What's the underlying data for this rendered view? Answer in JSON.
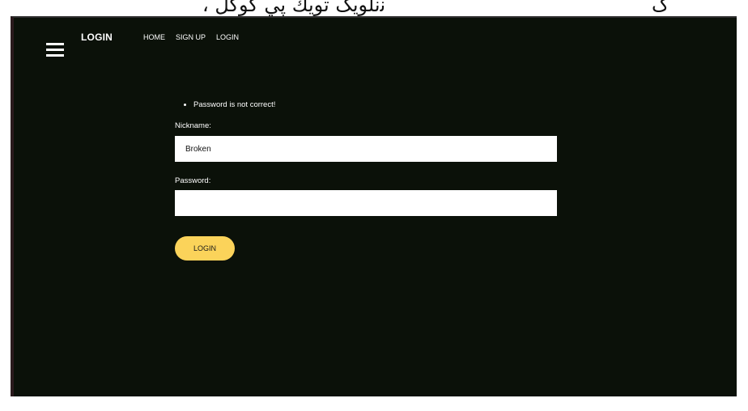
{
  "header": {
    "brand": "LOGIN",
    "nav": {
      "home": "HOME",
      "signup": "SIGN UP",
      "login": "LOGIN"
    }
  },
  "form": {
    "errors": [
      "Password is not correct!"
    ],
    "nickname_label": "Nickname:",
    "nickname_value": "Broken",
    "password_label": "Password:",
    "password_value": "",
    "submit_label": "LOGIN"
  },
  "colors": {
    "background": "#0b1109",
    "button": "#fbd35a",
    "text": "#ffffff"
  },
  "icons": {
    "menu": "hamburger-menu-icon"
  }
}
